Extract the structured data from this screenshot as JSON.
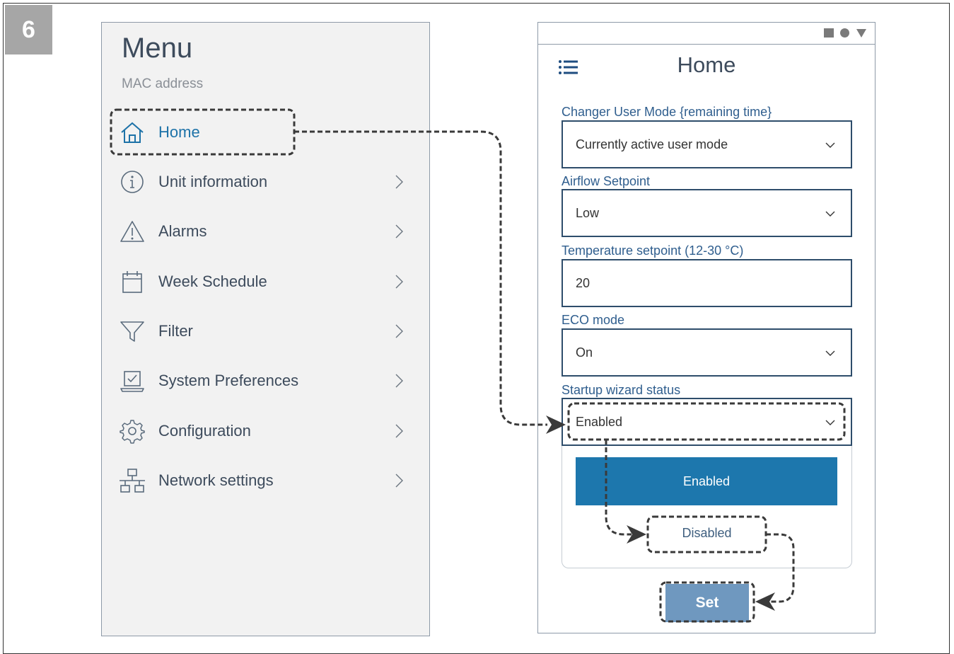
{
  "step_number": "6",
  "menu": {
    "title": "Menu",
    "subtitle": "MAC address",
    "items": [
      {
        "label": "Home",
        "icon": "home-icon"
      },
      {
        "label": "Unit information",
        "icon": "info-icon"
      },
      {
        "label": "Alarms",
        "icon": "warning-icon"
      },
      {
        "label": "Week Schedule",
        "icon": "calendar-icon"
      },
      {
        "label": "Filter",
        "icon": "filter-icon"
      },
      {
        "label": "System Preferences",
        "icon": "laptop-check-icon"
      },
      {
        "label": "Configuration",
        "icon": "gear-icon"
      },
      {
        "label": "Network settings",
        "icon": "network-icon"
      }
    ]
  },
  "home_screen": {
    "title": "Home",
    "fields": [
      {
        "label": "Changer User Mode {remaining time}",
        "value": "Currently active user mode",
        "type": "select"
      },
      {
        "label": "Airflow Setpoint",
        "value": "Low",
        "type": "select"
      },
      {
        "label": "Temperature setpoint (12-30 °C)",
        "value": "20",
        "type": "input"
      },
      {
        "label": "ECO mode",
        "value": "On",
        "type": "select"
      },
      {
        "label": "Startup wizard status",
        "value": "Enabled",
        "type": "select"
      }
    ],
    "dropdown_options": [
      "Enabled",
      "Disabled"
    ],
    "set_button": "Set"
  },
  "colors": {
    "accent": "#1d77ad",
    "set_button": "#6f98bf",
    "badge": "#a6a6a6",
    "field_border": "#2e4d6b"
  }
}
